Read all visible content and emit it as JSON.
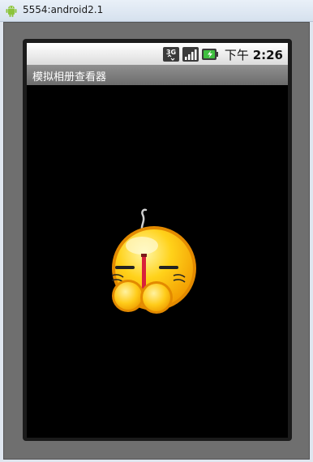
{
  "window": {
    "title": "5554:android2.1",
    "icon": "android-icon"
  },
  "status_bar": {
    "icons": [
      "3g-icon",
      "signal-icon",
      "battery-icon"
    ],
    "network_label": "3G",
    "time_ampm": "下午",
    "time": "2:26"
  },
  "app": {
    "title": "模拟相册查看器"
  },
  "content": {
    "image": "blushing-smiley-emoticon"
  },
  "colors": {
    "screen_background": "#000000",
    "emulator_frame": "#6f6f6f",
    "title_bar": "#7c7c7c"
  }
}
